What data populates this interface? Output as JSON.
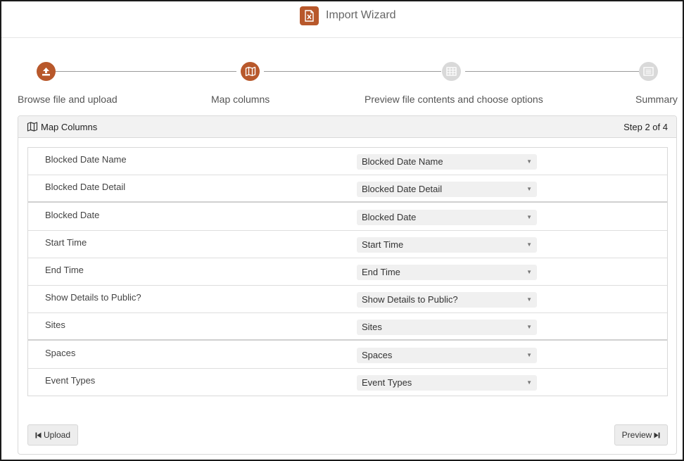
{
  "header": {
    "title": "Import Wizard",
    "icon": "excel-file-icon",
    "accent": "#b8582b"
  },
  "steps": [
    {
      "label": "Browse file and upload",
      "icon": "upload-icon",
      "state": "complete"
    },
    {
      "label": "Map columns",
      "icon": "map-icon",
      "state": "current"
    },
    {
      "label": "Preview file contents and choose options",
      "icon": "table-icon",
      "state": "pending"
    },
    {
      "label": "Summary",
      "icon": "summary-icon",
      "state": "pending"
    }
  ],
  "panel": {
    "title": "Map Columns",
    "step_text": "Step 2 of 4",
    "icon": "map-icon"
  },
  "mappings": [
    {
      "label": "Blocked Date Name",
      "value": "Blocked Date Name"
    },
    {
      "label": "Blocked Date Detail",
      "value": "Blocked Date Detail"
    },
    {
      "label": "Blocked Date",
      "value": "Blocked Date"
    },
    {
      "label": "Start Time",
      "value": "Start Time"
    },
    {
      "label": "End Time",
      "value": "End Time"
    },
    {
      "label": "Show Details to Public?",
      "value": "Show Details to Public?"
    },
    {
      "label": "Sites",
      "value": "Sites"
    },
    {
      "label": "Spaces",
      "value": "Spaces"
    },
    {
      "label": "Event Types",
      "value": "Event Types"
    }
  ],
  "buttons": {
    "back_label": "Upload",
    "next_label": "Preview"
  },
  "colors": {
    "active": "#b8582b",
    "inactive": "#d9d9d9"
  }
}
